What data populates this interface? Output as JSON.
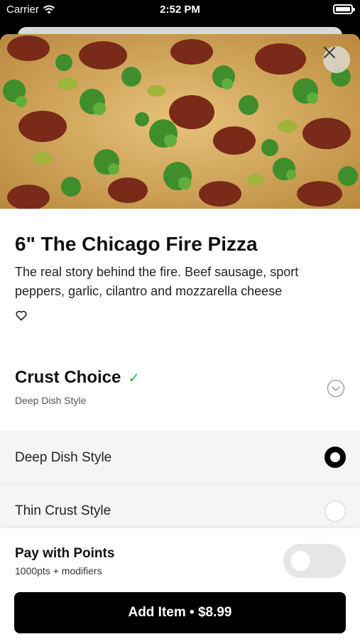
{
  "status_bar": {
    "carrier": "Carrier",
    "time": "2:52 PM"
  },
  "item": {
    "title": "6\" The Chicago Fire Pizza",
    "description": "The real story behind the fire. Beef sausage, sport peppers, garlic, cilantro and mozzarella cheese"
  },
  "crust": {
    "title": "Crust Choice",
    "check": "✓",
    "selected": "Deep Dish Style",
    "options": [
      {
        "label": "Deep Dish Style",
        "selected": true
      },
      {
        "label": "Thin Crust Style",
        "selected": false
      }
    ]
  },
  "points": {
    "title": "Pay with Points",
    "subtitle": "1000pts + modifiers",
    "enabled": false
  },
  "add_button": {
    "label": "Add Item • $8.99"
  },
  "colors": {
    "accent_check": "#2fae4f",
    "button_bg": "#000000",
    "options_bg": "#f5f5f5"
  }
}
